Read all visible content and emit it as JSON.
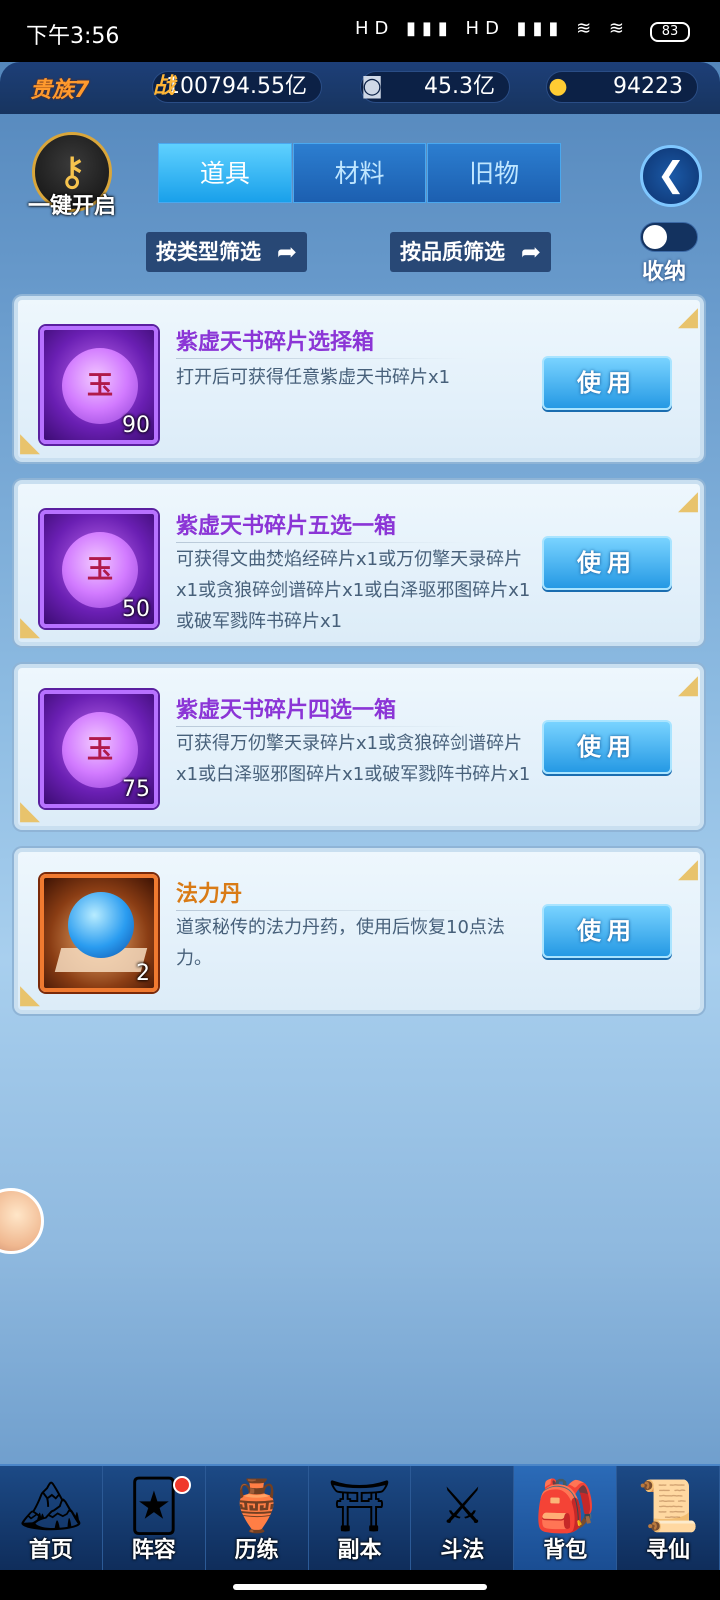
{
  "status_bar": {
    "time": "下午3:56",
    "signal": "HD ▮▮▮ HD ▮▮▮ ≋ ≋",
    "battery": "83"
  },
  "currency": {
    "vip": "贵族7",
    "power_icon": "战",
    "power": "100794.55亿",
    "coins": "45.3亿",
    "gold": "94223"
  },
  "toolbar": {
    "one_key_open": "一键开启",
    "tabs": [
      "道具",
      "材料",
      "旧物"
    ],
    "active_tab": 0,
    "filter_type": "按类型筛选",
    "filter_quality": "按品质筛选",
    "collect_label": "收纳",
    "collect_on": false
  },
  "items": [
    {
      "name": "紫虚天书碎片选择箱",
      "desc": "打开后可获得任意紫虚天书碎片x1",
      "qty": "90",
      "icon_char": "玉",
      "rarity": "purple",
      "use_label": "使用"
    },
    {
      "name": "紫虚天书碎片五选一箱",
      "desc": "可获得文曲焚焰经碎片x1或万仞擎天录碎片x1或贪狼碎剑谱碎片x1或白泽驱邪图碎片x1或破军戮阵书碎片x1",
      "qty": "50",
      "icon_char": "玉",
      "rarity": "purple",
      "use_label": "使用"
    },
    {
      "name": "紫虚天书碎片四选一箱",
      "desc": "可获得万仞擎天录碎片x1或贪狼碎剑谱碎片x1或白泽驱邪图碎片x1或破军戮阵书碎片x1",
      "qty": "75",
      "icon_char": "玉",
      "rarity": "purple",
      "use_label": "使用"
    },
    {
      "name": "法力丹",
      "desc": "道家秘传的法力丹药，使用后恢复10点法力。",
      "qty": "2",
      "icon_char": "",
      "rarity": "orange",
      "use_label": "使用"
    }
  ],
  "nav": [
    {
      "label": "首页",
      "icon": "🏔",
      "badge": false
    },
    {
      "label": "阵容",
      "icon": "🃏",
      "badge": true
    },
    {
      "label": "历练",
      "icon": "🏺",
      "badge": false
    },
    {
      "label": "副本",
      "icon": "⛩",
      "badge": false
    },
    {
      "label": "斗法",
      "icon": "⚔",
      "badge": false
    },
    {
      "label": "背包",
      "icon": "🎒",
      "badge": false
    },
    {
      "label": "寻仙",
      "icon": "📜",
      "badge": false
    }
  ],
  "active_nav": 5
}
